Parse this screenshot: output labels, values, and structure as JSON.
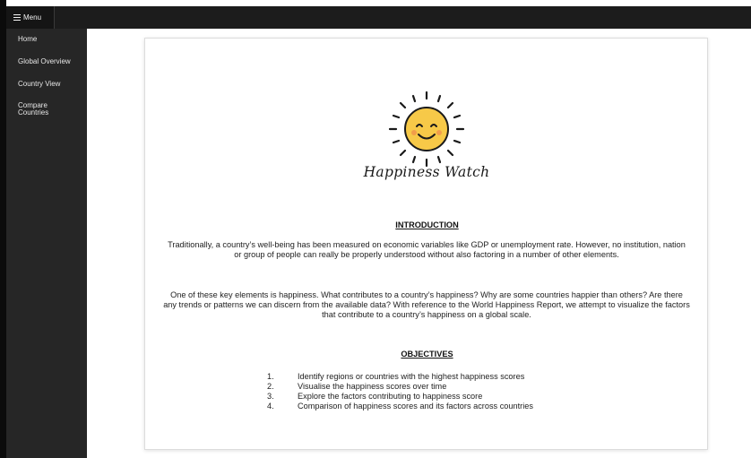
{
  "topbar": {
    "menu_label": "Menu"
  },
  "sidebar": {
    "items": [
      {
        "label": "Home"
      },
      {
        "label": "Global Overview"
      },
      {
        "label": "Country View"
      },
      {
        "label": "Compare Countries"
      }
    ]
  },
  "main": {
    "brand_name": "Happiness Watch",
    "intro_heading": "INTRODUCTION",
    "intro_p1": "Traditionally, a country’s well-being has been measured on economic variables like GDP or unemployment rate. However, no institution, nation or group of people can really be properly understood without also factoring in a number of other elements.",
    "intro_p2": "One of these key elements is happiness. What contributes to a country’s happiness? Why are some countries happier than others? Are there any trends or patterns we can discern from the available data? With reference to the World Happiness Report, we attempt to visualize the factors that contribute to a country’s happiness on a global scale.",
    "objectives_heading": "OBJECTIVES",
    "objectives": [
      {
        "num": "1.",
        "text": "Identify regions or countries with the highest happiness scores"
      },
      {
        "num": "2.",
        "text": "Visualise the happiness scores over time"
      },
      {
        "num": "3.",
        "text": "Explore the factors contributing to happiness score"
      },
      {
        "num": "4.",
        "text": "Comparison of happiness scores and its factors across countries"
      }
    ]
  },
  "colors": {
    "topbar": "#1c1c1c",
    "sidebar": "#262626",
    "sun": "#f7c948",
    "sun_outline": "#1a1a1a"
  },
  "icons": {
    "menu": "hamburger-icon",
    "logo": "smiling-sun-icon"
  }
}
